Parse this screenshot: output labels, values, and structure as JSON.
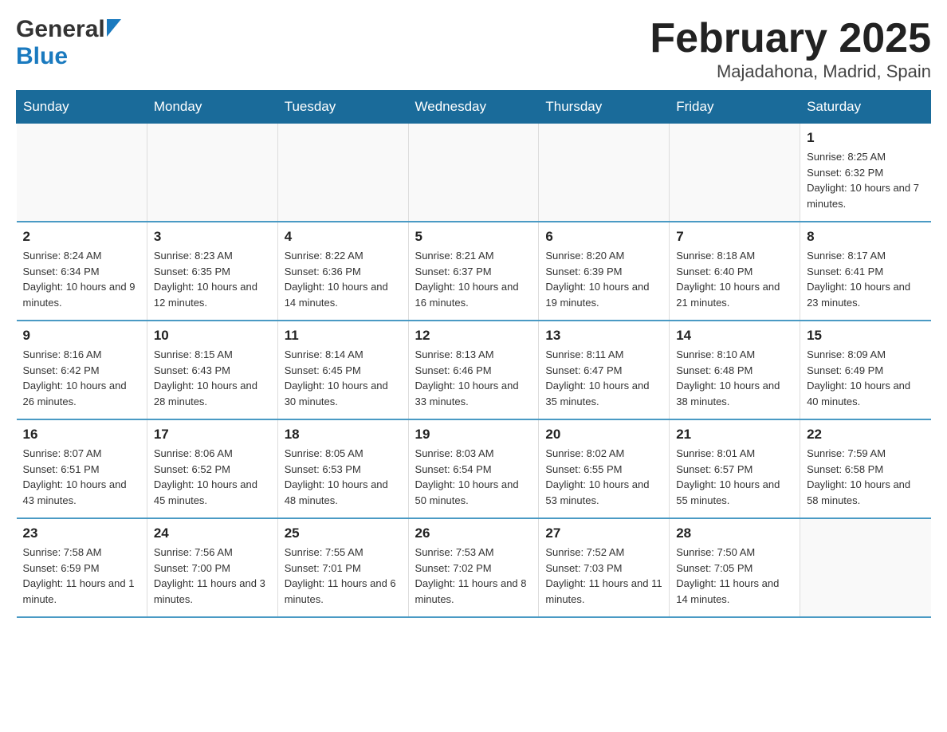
{
  "header": {
    "logo_general": "General",
    "logo_blue": "Blue",
    "month_title": "February 2025",
    "location": "Majadahona, Madrid, Spain"
  },
  "days_of_week": [
    "Sunday",
    "Monday",
    "Tuesday",
    "Wednesday",
    "Thursday",
    "Friday",
    "Saturday"
  ],
  "weeks": [
    {
      "days": [
        {
          "number": "",
          "info": ""
        },
        {
          "number": "",
          "info": ""
        },
        {
          "number": "",
          "info": ""
        },
        {
          "number": "",
          "info": ""
        },
        {
          "number": "",
          "info": ""
        },
        {
          "number": "",
          "info": ""
        },
        {
          "number": "1",
          "info": "Sunrise: 8:25 AM\nSunset: 6:32 PM\nDaylight: 10 hours and 7 minutes."
        }
      ]
    },
    {
      "days": [
        {
          "number": "2",
          "info": "Sunrise: 8:24 AM\nSunset: 6:34 PM\nDaylight: 10 hours and 9 minutes."
        },
        {
          "number": "3",
          "info": "Sunrise: 8:23 AM\nSunset: 6:35 PM\nDaylight: 10 hours and 12 minutes."
        },
        {
          "number": "4",
          "info": "Sunrise: 8:22 AM\nSunset: 6:36 PM\nDaylight: 10 hours and 14 minutes."
        },
        {
          "number": "5",
          "info": "Sunrise: 8:21 AM\nSunset: 6:37 PM\nDaylight: 10 hours and 16 minutes."
        },
        {
          "number": "6",
          "info": "Sunrise: 8:20 AM\nSunset: 6:39 PM\nDaylight: 10 hours and 19 minutes."
        },
        {
          "number": "7",
          "info": "Sunrise: 8:18 AM\nSunset: 6:40 PM\nDaylight: 10 hours and 21 minutes."
        },
        {
          "number": "8",
          "info": "Sunrise: 8:17 AM\nSunset: 6:41 PM\nDaylight: 10 hours and 23 minutes."
        }
      ]
    },
    {
      "days": [
        {
          "number": "9",
          "info": "Sunrise: 8:16 AM\nSunset: 6:42 PM\nDaylight: 10 hours and 26 minutes."
        },
        {
          "number": "10",
          "info": "Sunrise: 8:15 AM\nSunset: 6:43 PM\nDaylight: 10 hours and 28 minutes."
        },
        {
          "number": "11",
          "info": "Sunrise: 8:14 AM\nSunset: 6:45 PM\nDaylight: 10 hours and 30 minutes."
        },
        {
          "number": "12",
          "info": "Sunrise: 8:13 AM\nSunset: 6:46 PM\nDaylight: 10 hours and 33 minutes."
        },
        {
          "number": "13",
          "info": "Sunrise: 8:11 AM\nSunset: 6:47 PM\nDaylight: 10 hours and 35 minutes."
        },
        {
          "number": "14",
          "info": "Sunrise: 8:10 AM\nSunset: 6:48 PM\nDaylight: 10 hours and 38 minutes."
        },
        {
          "number": "15",
          "info": "Sunrise: 8:09 AM\nSunset: 6:49 PM\nDaylight: 10 hours and 40 minutes."
        }
      ]
    },
    {
      "days": [
        {
          "number": "16",
          "info": "Sunrise: 8:07 AM\nSunset: 6:51 PM\nDaylight: 10 hours and 43 minutes."
        },
        {
          "number": "17",
          "info": "Sunrise: 8:06 AM\nSunset: 6:52 PM\nDaylight: 10 hours and 45 minutes."
        },
        {
          "number": "18",
          "info": "Sunrise: 8:05 AM\nSunset: 6:53 PM\nDaylight: 10 hours and 48 minutes."
        },
        {
          "number": "19",
          "info": "Sunrise: 8:03 AM\nSunset: 6:54 PM\nDaylight: 10 hours and 50 minutes."
        },
        {
          "number": "20",
          "info": "Sunrise: 8:02 AM\nSunset: 6:55 PM\nDaylight: 10 hours and 53 minutes."
        },
        {
          "number": "21",
          "info": "Sunrise: 8:01 AM\nSunset: 6:57 PM\nDaylight: 10 hours and 55 minutes."
        },
        {
          "number": "22",
          "info": "Sunrise: 7:59 AM\nSunset: 6:58 PM\nDaylight: 10 hours and 58 minutes."
        }
      ]
    },
    {
      "days": [
        {
          "number": "23",
          "info": "Sunrise: 7:58 AM\nSunset: 6:59 PM\nDaylight: 11 hours and 1 minute."
        },
        {
          "number": "24",
          "info": "Sunrise: 7:56 AM\nSunset: 7:00 PM\nDaylight: 11 hours and 3 minutes."
        },
        {
          "number": "25",
          "info": "Sunrise: 7:55 AM\nSunset: 7:01 PM\nDaylight: 11 hours and 6 minutes."
        },
        {
          "number": "26",
          "info": "Sunrise: 7:53 AM\nSunset: 7:02 PM\nDaylight: 11 hours and 8 minutes."
        },
        {
          "number": "27",
          "info": "Sunrise: 7:52 AM\nSunset: 7:03 PM\nDaylight: 11 hours and 11 minutes."
        },
        {
          "number": "28",
          "info": "Sunrise: 7:50 AM\nSunset: 7:05 PM\nDaylight: 11 hours and 14 minutes."
        },
        {
          "number": "",
          "info": ""
        }
      ]
    }
  ]
}
